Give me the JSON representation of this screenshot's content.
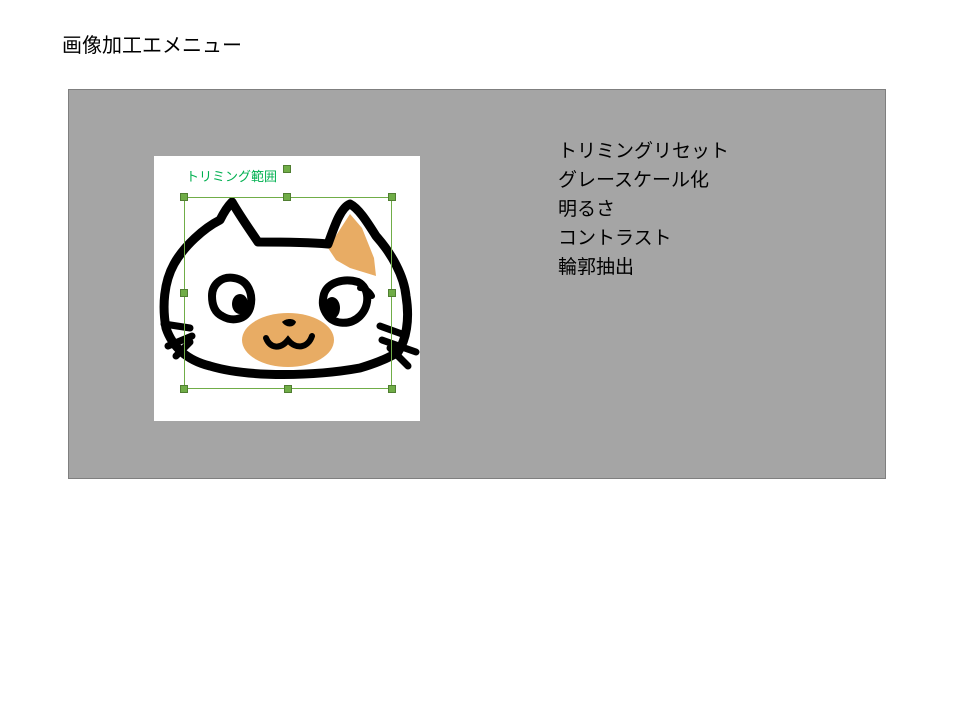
{
  "page": {
    "title": "画像加工エメニュー"
  },
  "colors": {
    "panel_background": "#a5a5a5",
    "panel_border": "#7f7f7f",
    "trim_border": "#70ad47",
    "trim_label": "#00b050",
    "handle_fill": "#70ad47",
    "cat_outline": "#000000",
    "cat_patch": "#e8ac64"
  },
  "image": {
    "subject": "cat face illustration",
    "trim_label": "トリミング範囲"
  },
  "menu": {
    "items": [
      "トリミングリセット",
      "グレースケール化",
      "明るさ",
      "コントラスト",
      "輪郭抽出"
    ]
  }
}
